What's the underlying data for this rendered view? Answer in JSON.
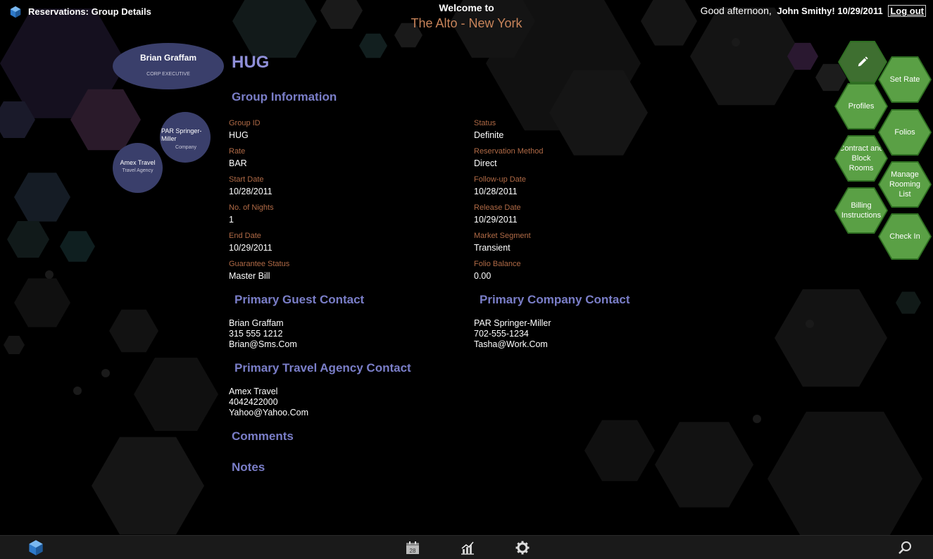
{
  "header": {
    "title": "Reservations: Group Details",
    "welcome": "Welcome to",
    "property": "The Alto - New York",
    "greeting": "Good afternoon,",
    "user": "John Smithy!",
    "date": "10/29/2011",
    "logout": "Log out"
  },
  "profiles": {
    "main": {
      "name": "Brian Graffam",
      "role": "CORP EXECUTIVE"
    },
    "company": {
      "name": "PAR Springer-Miller",
      "type": "Company"
    },
    "agency": {
      "name": "Amex Travel",
      "type": "Travel Agency"
    }
  },
  "group": {
    "code": "HUG",
    "section_title": "Group Information",
    "fields_left": [
      {
        "label": "Group ID",
        "value": "HUG"
      },
      {
        "label": "Rate",
        "value": "BAR"
      },
      {
        "label": "Start Date",
        "value": "10/28/2011"
      },
      {
        "label": "No. of Nights",
        "value": "1"
      },
      {
        "label": "End Date",
        "value": "10/29/2011"
      },
      {
        "label": "Guarantee Status",
        "value": "Master Bill"
      }
    ],
    "fields_right": [
      {
        "label": "Status",
        "value": "Definite"
      },
      {
        "label": "Reservation Method",
        "value": "Direct"
      },
      {
        "label": "Follow-up Date",
        "value": "10/28/2011"
      },
      {
        "label": "Release Date",
        "value": "10/29/2011"
      },
      {
        "label": "Market Segment",
        "value": "Transient"
      },
      {
        "label": "Folio Balance",
        "value": "0.00"
      }
    ]
  },
  "contacts": {
    "guest": {
      "title": "Primary Guest Contact",
      "lines": [
        "Brian Graffam",
        "315 555 1212",
        "Brian@Sms.Com"
      ]
    },
    "company": {
      "title": "Primary Company Contact",
      "lines": [
        "PAR Springer-Miller",
        "702-555-1234",
        "Tasha@Work.Com"
      ]
    },
    "agency": {
      "title": "Primary Travel Agency Contact",
      "lines": [
        "Amex Travel",
        "4042422000",
        "Yahoo@Yahoo.Com"
      ]
    }
  },
  "sections": {
    "comments": "Comments",
    "notes": "Notes"
  },
  "actions": {
    "edit_icon": "pencil-icon",
    "set_rate": "Set Rate",
    "profiles": "Profiles",
    "folios": "Folios",
    "contract": "Contract and Block Rooms",
    "rooming": "Manage Rooming List",
    "billing": "Billing Instructions",
    "checkin": "Check In"
  },
  "bottombar": {
    "icons": [
      "app-logo-icon",
      "calendar-icon",
      "chart-icon",
      "gear-icon",
      "search-icon"
    ],
    "calendar_day": "28"
  },
  "colors": {
    "heading": "#7a7ec8",
    "label": "#b06a46",
    "property": "#c8845a",
    "hex_fill": "#5aa045",
    "bubble": "#3a3f6b"
  }
}
